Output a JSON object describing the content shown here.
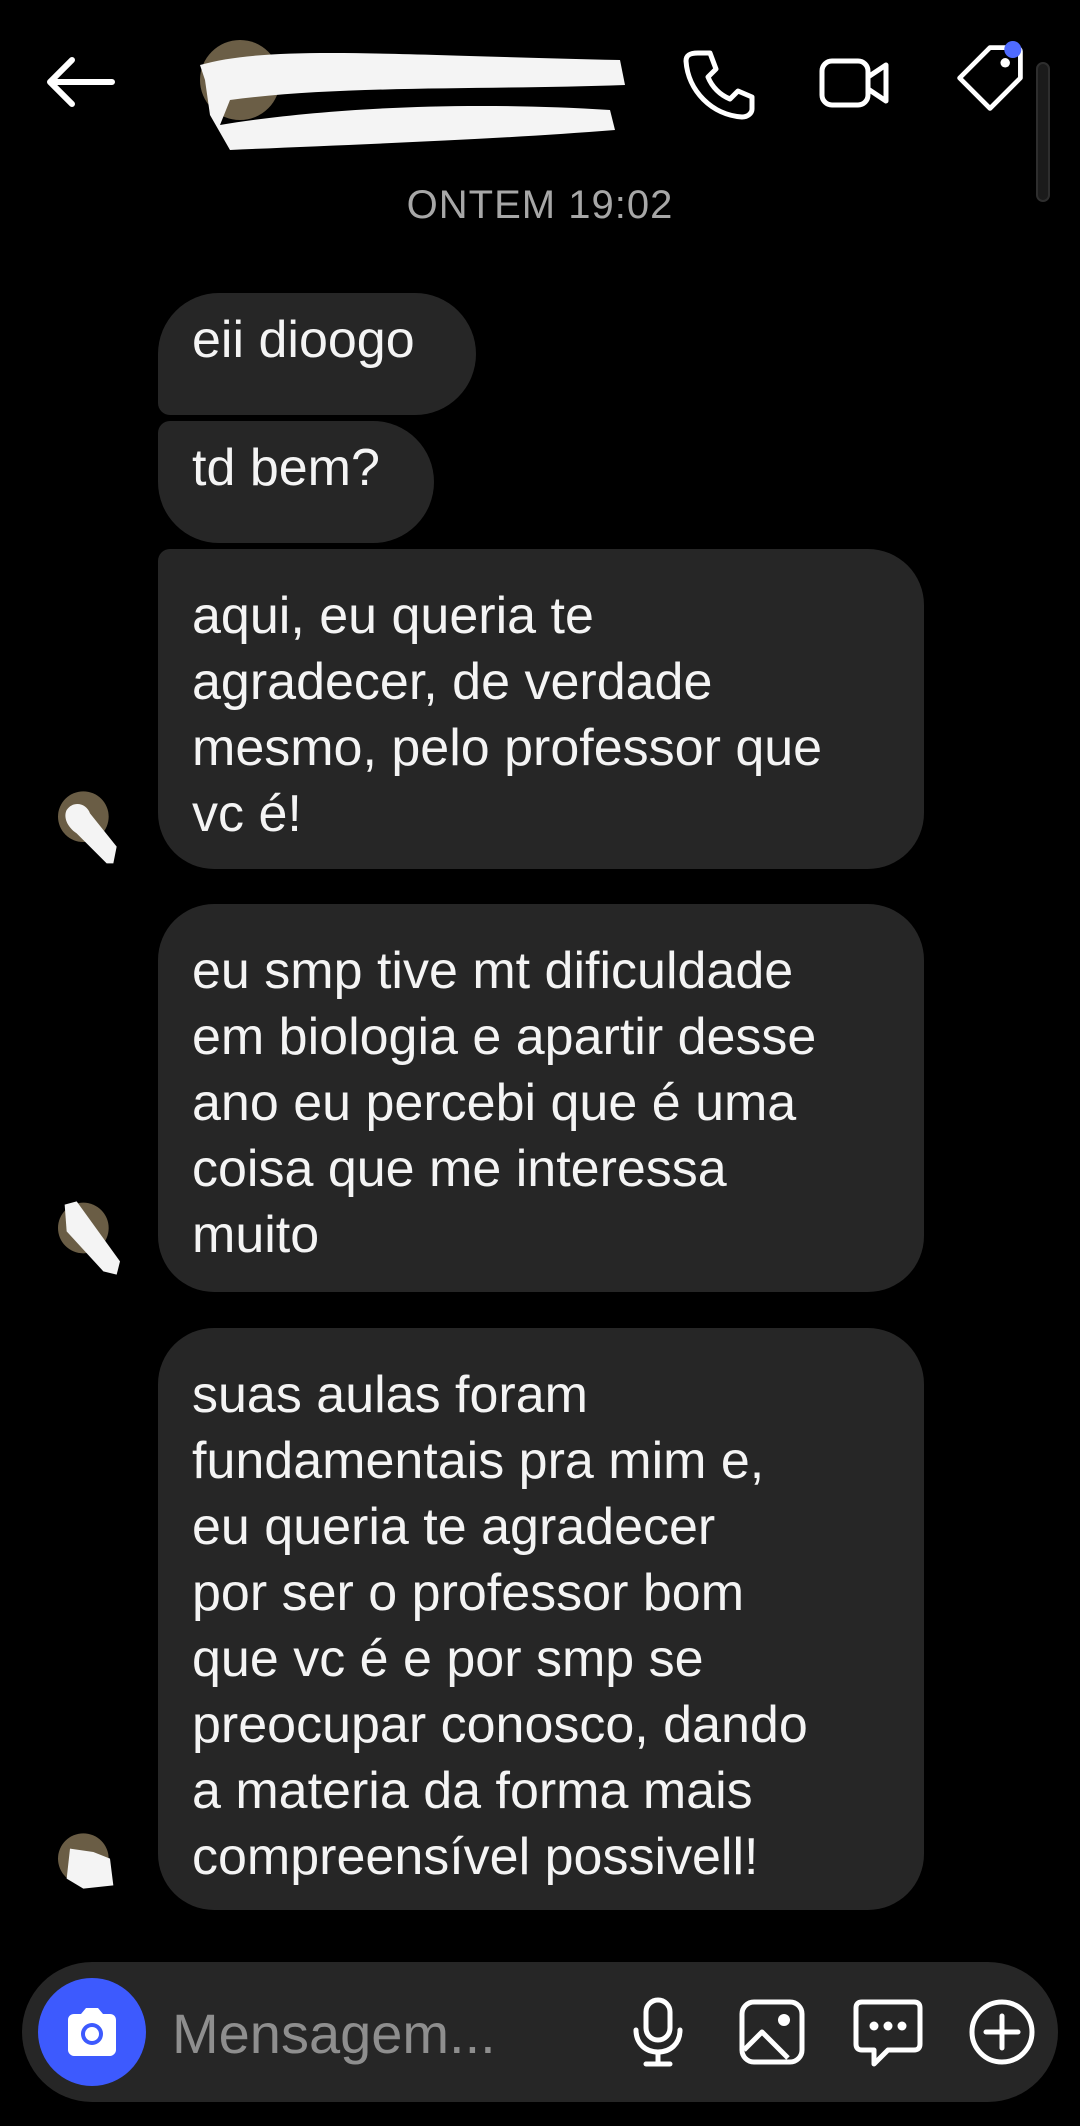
{
  "header": {
    "contact_name": "",
    "icons": [
      "back-arrow-icon",
      "phone-icon",
      "video-icon",
      "tag-icon"
    ]
  },
  "conversation": {
    "date_separator": "ONTEM 19:02",
    "messages": [
      {
        "lines": [
          "eii dioogo"
        ]
      },
      {
        "lines": [
          "td bem?"
        ]
      },
      {
        "lines": [
          "aqui, eu queria te",
          "agradecer, de verdade",
          "mesmo, pelo professor que",
          "vc é!"
        ]
      },
      {
        "lines": [
          "eu smp tive mt dificuldade",
          "em biologia e apartir desse",
          "ano eu percebi que é uma",
          "coisa que me interessa",
          "muito"
        ]
      },
      {
        "lines": [
          "suas aulas foram",
          "fundamentais pra mim e,",
          "eu queria te agradecer",
          "por ser o professor bom",
          "que vc é e por smp se",
          "preocupar conosco, dando",
          "a materia da forma mais",
          "compreensível possivell!"
        ]
      }
    ]
  },
  "composer": {
    "placeholder": "Mensagem...",
    "icons": [
      "camera-icon",
      "microphone-icon",
      "gallery-icon",
      "sticker-chat-icon",
      "add-icon"
    ]
  },
  "colors": {
    "background": "#000000",
    "bubble": "#262626",
    "accent": "#3d5afe",
    "notification_dot": "#4f6bff"
  }
}
